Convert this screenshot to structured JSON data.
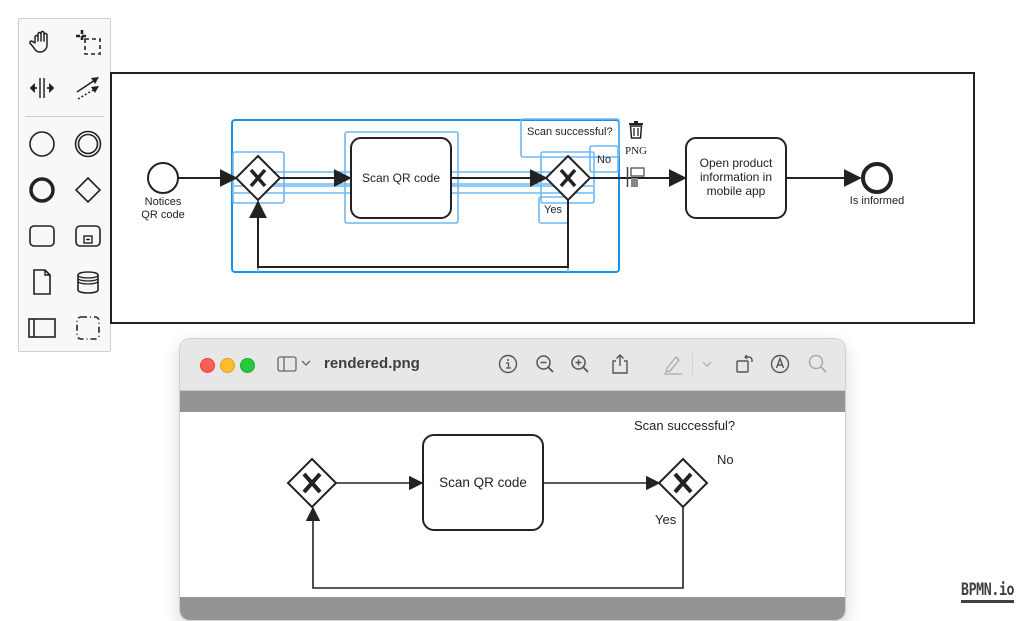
{
  "palette": {
    "tools": [
      {
        "name": "hand-tool",
        "icon": "hand-icon"
      },
      {
        "name": "lasso-tool",
        "icon": "lasso-icon"
      },
      {
        "name": "space-tool",
        "icon": "space-icon"
      },
      {
        "name": "global-connect-tool",
        "icon": "connect-icon"
      },
      {
        "name": "create-start-event",
        "icon": "start-event-icon"
      },
      {
        "name": "create-intermediate-event",
        "icon": "intermediate-event-icon"
      },
      {
        "name": "create-end-event",
        "icon": "end-event-icon"
      },
      {
        "name": "create-gateway",
        "icon": "gateway-icon"
      },
      {
        "name": "create-task",
        "icon": "task-icon"
      },
      {
        "name": "create-subprocess",
        "icon": "subprocess-icon"
      },
      {
        "name": "create-data-object",
        "icon": "data-object-icon"
      },
      {
        "name": "create-data-store",
        "icon": "data-store-icon"
      },
      {
        "name": "create-pool",
        "icon": "pool-icon"
      },
      {
        "name": "create-group",
        "icon": "group-icon"
      }
    ]
  },
  "diagram": {
    "start_event_label": [
      "Notices",
      "QR code"
    ],
    "scan_task_label": "Scan QR code",
    "gateway_question": "Scan successful?",
    "no_label": "No",
    "yes_label": "Yes",
    "open_task_label": [
      "Open product",
      "information in",
      "mobile app"
    ],
    "end_event_label": "Is informed",
    "context_pad": {
      "delete": "trash-icon",
      "export_label": "PNG",
      "replace": "replace-icon"
    },
    "selection_color": "#1a8fe8",
    "selection_light_color": "#6db8f2"
  },
  "preview": {
    "title": "rendered.png",
    "toolbar": [
      "sidebar-icon",
      "chevron-down-icon",
      "info-icon",
      "zoom-out-icon",
      "zoom-in-icon",
      "share-icon",
      "markup-pen-icon",
      "chevron-down-icon",
      "rotate-icon",
      "annotate-icon",
      "search-icon"
    ],
    "image": {
      "scan_task_label": "Scan QR code",
      "gateway_question": "Scan successful?",
      "no_label": "No",
      "yes_label": "Yes"
    }
  },
  "watermark": "BPMN.io"
}
